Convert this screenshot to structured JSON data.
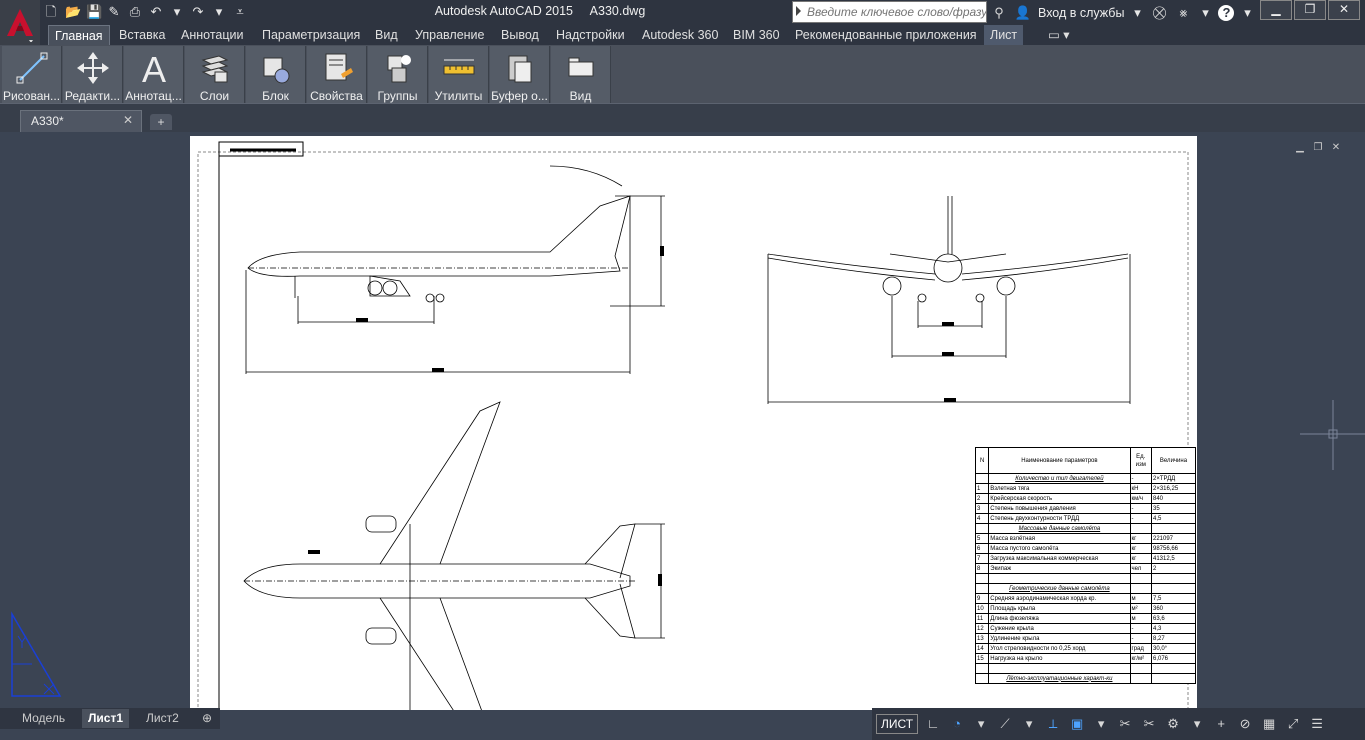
{
  "window": {
    "title": "Autodesk AutoCAD 2015     A330.dwg",
    "search_placeholder": "Введите ключевое слово/фразу",
    "signin_label": "Вход в службы"
  },
  "quick_access_icons": [
    "new-icon",
    "open-icon",
    "save-icon",
    "saveas-icon",
    "print-icon",
    "undo-icon",
    "redo-icon",
    "customize-icon"
  ],
  "menu_tabs": [
    {
      "label": "Главная",
      "active": true
    },
    {
      "label": "Вставка"
    },
    {
      "label": "Аннотации"
    },
    {
      "label": "Параметризация"
    },
    {
      "label": "Вид"
    },
    {
      "label": "Управление"
    },
    {
      "label": "Вывод"
    },
    {
      "label": "Надстройки"
    },
    {
      "label": "Autodesk 360"
    },
    {
      "label": "BIM 360"
    },
    {
      "label": "Рекомендованные приложения"
    },
    {
      "label": "Лист",
      "highlight": true
    }
  ],
  "ribbon_buttons": [
    {
      "label": "Рисован...",
      "icon": "line-icon"
    },
    {
      "label": "Редакти...",
      "icon": "move-icon"
    },
    {
      "label": "Аннотац...",
      "icon": "text-icon"
    },
    {
      "label": "Слои",
      "icon": "layers-icon"
    },
    {
      "label": "Блок",
      "icon": "block-icon"
    },
    {
      "label": "Свойства",
      "icon": "properties-icon"
    },
    {
      "label": "Группы",
      "icon": "groups-icon"
    },
    {
      "label": "Утилиты",
      "icon": "measure-icon"
    },
    {
      "label": "Буфер о...",
      "icon": "clipboard-icon"
    },
    {
      "label": "Вид",
      "icon": "view-icon"
    }
  ],
  "file_tab": {
    "label": "A330*"
  },
  "layout_tabs": [
    {
      "label": "Модель"
    },
    {
      "label": "Лист1",
      "active": true
    },
    {
      "label": "Лист2"
    }
  ],
  "status": {
    "space_label": "ЛИСТ"
  },
  "spec_table": {
    "header": {
      "n": "N",
      "name": "Наименование параметров",
      "unit": "Ед. изм",
      "value": "Величина"
    },
    "rows": [
      {
        "section": "Количество и тип двигателей",
        "unit": "-",
        "value": "2×ТРДД"
      },
      {
        "n": "1",
        "name": "Взлетная тяга",
        "unit": "кН",
        "value": "2×316,25"
      },
      {
        "n": "2",
        "name": "Крейсерская скорость",
        "unit": "км/ч",
        "value": "840"
      },
      {
        "n": "3",
        "name": "Степень повышения давления",
        "unit": "-",
        "value": "35"
      },
      {
        "n": "4",
        "name": "Степень двухконтурности ТРДД",
        "unit": "-",
        "value": "4,5"
      },
      {
        "section": "Массовые данные самолёта"
      },
      {
        "n": "5",
        "name": "Масса взлётная",
        "unit": "кг",
        "value": "221097"
      },
      {
        "n": "6",
        "name": "Масса пустого самолёта",
        "unit": "кг",
        "value": "98756,66"
      },
      {
        "n": "7",
        "name": "Загрузка максимальная коммерческая",
        "unit": "кг",
        "value": "41312,5"
      },
      {
        "n": "8",
        "name": "Экипаж",
        "unit": "чел",
        "value": "2"
      },
      {
        "section": ""
      },
      {
        "section": "Геометрические данные самолёта"
      },
      {
        "n": "9",
        "name": "Средняя аэродинамическая хорда кр.",
        "unit": "м",
        "value": "7,5"
      },
      {
        "n": "10",
        "name": "Площадь крыла",
        "unit": "м²",
        "value": "360"
      },
      {
        "n": "11",
        "name": "Длина фюзеляжа",
        "unit": "м",
        "value": "63,6"
      },
      {
        "n": "12",
        "name": "Сужение крыла",
        "unit": "-",
        "value": "4,3"
      },
      {
        "n": "13",
        "name": "Удлинение крыла",
        "unit": "-",
        "value": "8,27"
      },
      {
        "n": "14",
        "name": "Угол стреловидности по 0,25 хорд",
        "unit": "град",
        "value": "30,0°"
      },
      {
        "n": "15",
        "name": "Нагрузка на крыло",
        "unit": "кг/м²",
        "value": "6,076"
      },
      {
        "section": ""
      },
      {
        "section": "Лётно-эксплуатационные характ-ки"
      }
    ]
  },
  "colors": {
    "accent_red": "#c8102e",
    "ribbon_bg": "#4a505b",
    "workspace_bg": "#3b4453",
    "ucs_blue": "#1a3fd6"
  }
}
